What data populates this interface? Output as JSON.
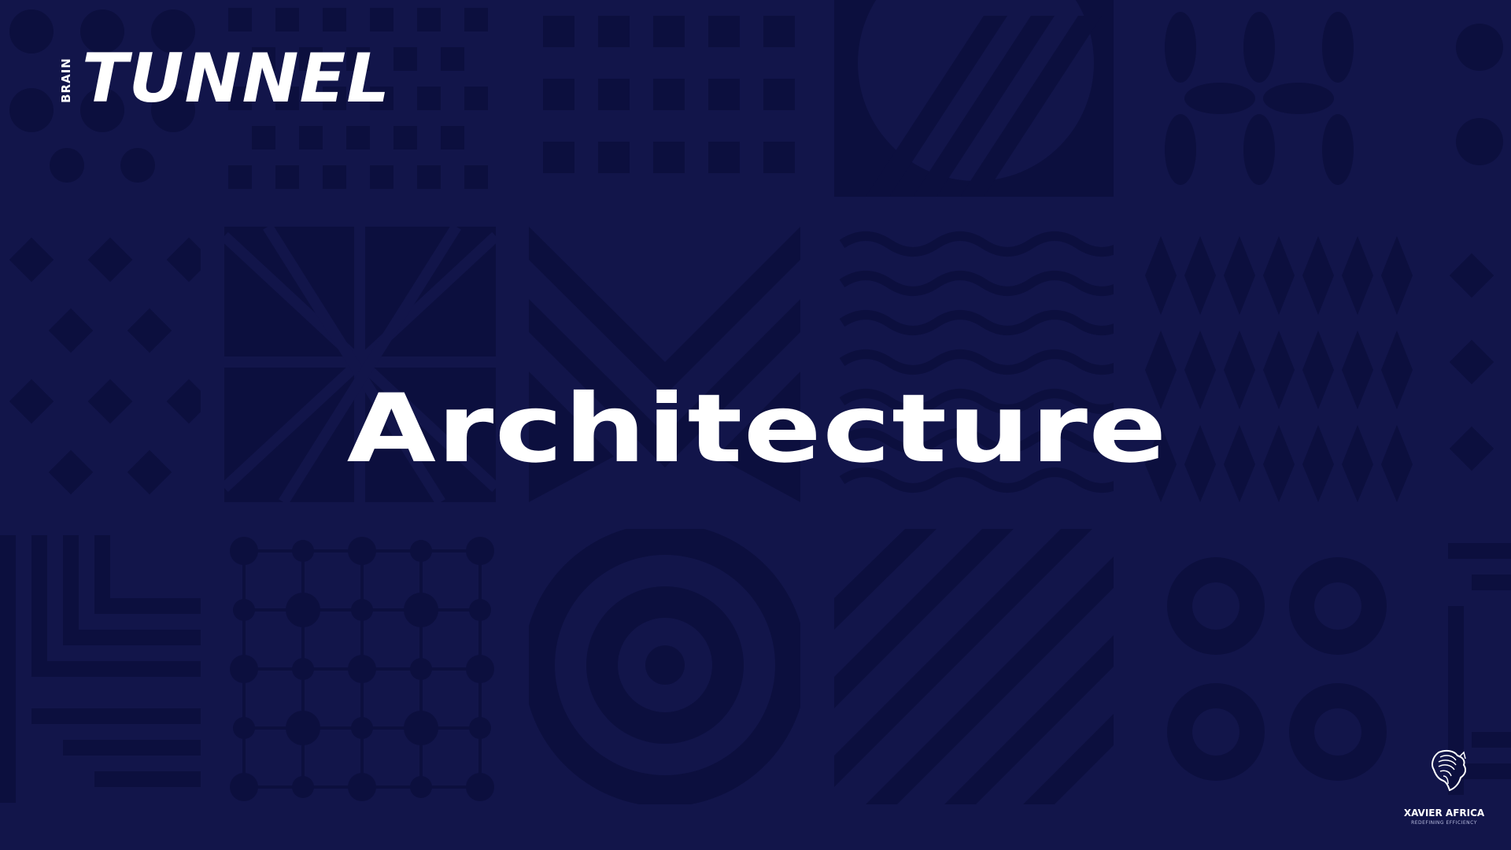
{
  "brand": {
    "small": "BRAIN",
    "big": "TUNNEL"
  },
  "slide": {
    "title": "Architecture"
  },
  "footer": {
    "company": "XAVIER AFRICA",
    "tagline": "REDEFINING EFFICIENCY",
    "logo_icon": "africa-fingerprint-lion-icon"
  },
  "colors": {
    "background": "#12154a",
    "pattern": "#0c0f3e",
    "text": "#ffffff"
  }
}
